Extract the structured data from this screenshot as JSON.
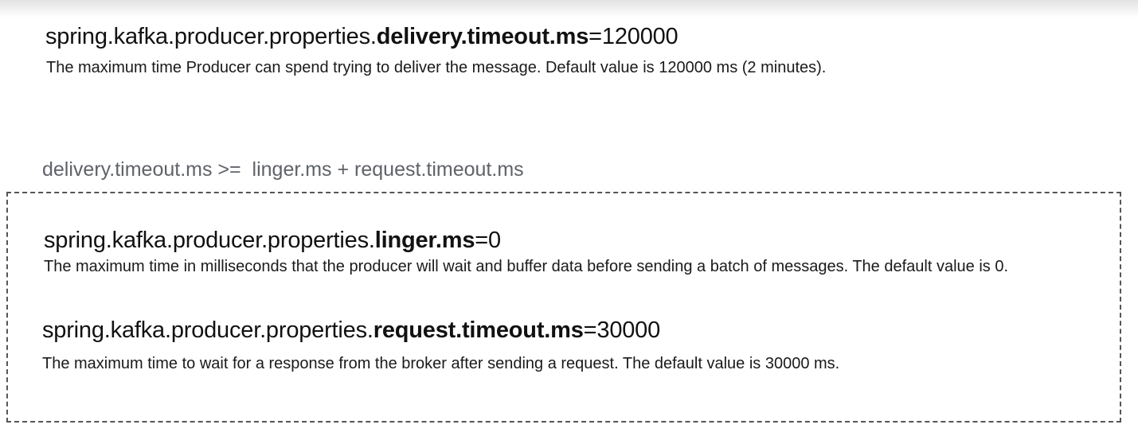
{
  "delivery": {
    "prefix": "spring.kafka.producer.properties.",
    "key": "delivery.timeout.ms",
    "value": "=120000",
    "description": "The maximum time Producer can spend trying to deliver the message. Default value is 120000 ms (2 minutes)."
  },
  "formula": "delivery.timeout.ms >=  linger.ms + request.timeout.ms",
  "linger": {
    "prefix": "spring.kafka.producer.properties.",
    "key": "linger.ms",
    "value": "=0",
    "description": "The maximum time in milliseconds that the producer will wait and buffer data before sending a batch of messages. The default value is 0."
  },
  "request": {
    "prefix": "spring.kafka.producer.properties.",
    "key": "request.timeout.ms",
    "value": "=30000",
    "description": "The maximum time to wait for a response from the broker after sending a request. The default value is 30000 ms."
  }
}
